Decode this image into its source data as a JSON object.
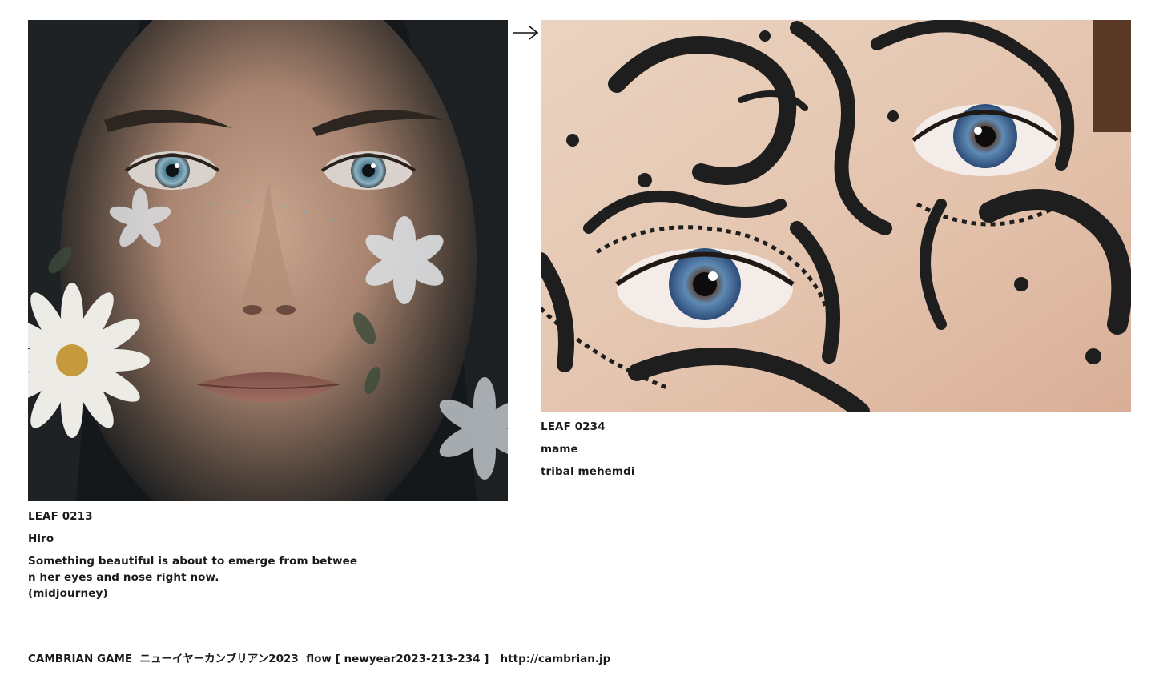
{
  "navigation": {
    "arrow_icon": "right-arrow-icon"
  },
  "left_card": {
    "image_icon": "portrait-flowers-image",
    "code": "LEAF 0213",
    "author": "Hiro",
    "description_lines": [
      "Something beautiful is about to emerge from betwee",
      "n her eyes and nose right now.",
      "(midjourney)"
    ]
  },
  "right_card": {
    "image_icon": "tribal-mehendi-eyes-image",
    "code": "LEAF 0234",
    "author": "mame",
    "title": "tribal mehemdi"
  },
  "footer": {
    "text": "CAMBRIAN GAME  ニューイヤーカンブリアン2023  flow [ newyear2023-213-234 ]   ",
    "link": "http://cambrian.jp"
  }
}
